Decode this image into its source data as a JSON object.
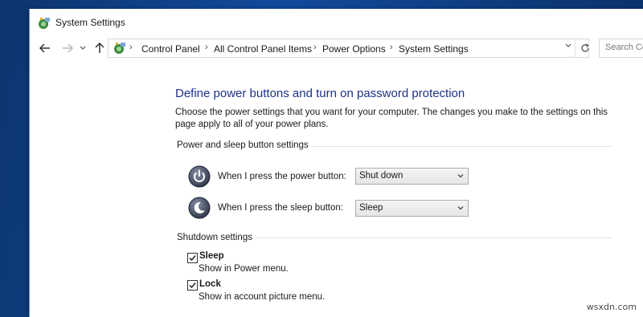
{
  "window": {
    "title": "System Settings"
  },
  "navigation": {
    "back_icon": "arrow-left-icon",
    "forward_icon": "arrow-right-icon",
    "recent_icon": "chevron-down-icon",
    "up_icon": "arrow-up-icon",
    "breadcrumbs": [
      "Control Panel",
      "All Control Panel Items",
      "Power Options",
      "System Settings"
    ],
    "search_placeholder": "Search Co"
  },
  "page": {
    "heading": "Define power buttons and turn on password protection",
    "description": "Choose the power settings that you want for your computer. The changes you make to the settings on this page apply to all of your power plans.",
    "power_section": {
      "title": "Power and sleep button settings",
      "power_button": {
        "label": "When I press the power button:",
        "value": "Shut down"
      },
      "sleep_button": {
        "label": "When I press the sleep button:",
        "value": "Sleep"
      }
    },
    "shutdown_section": {
      "title": "Shutdown settings",
      "items": [
        {
          "label": "Sleep",
          "sub": "Show in Power menu.",
          "checked": true
        },
        {
          "label": "Lock",
          "sub": "Show in account picture menu.",
          "checked": true
        }
      ]
    }
  },
  "watermark": "wsxdn.com",
  "colors": {
    "heading": "#1e3287",
    "desktop": "#0f3f8c"
  }
}
